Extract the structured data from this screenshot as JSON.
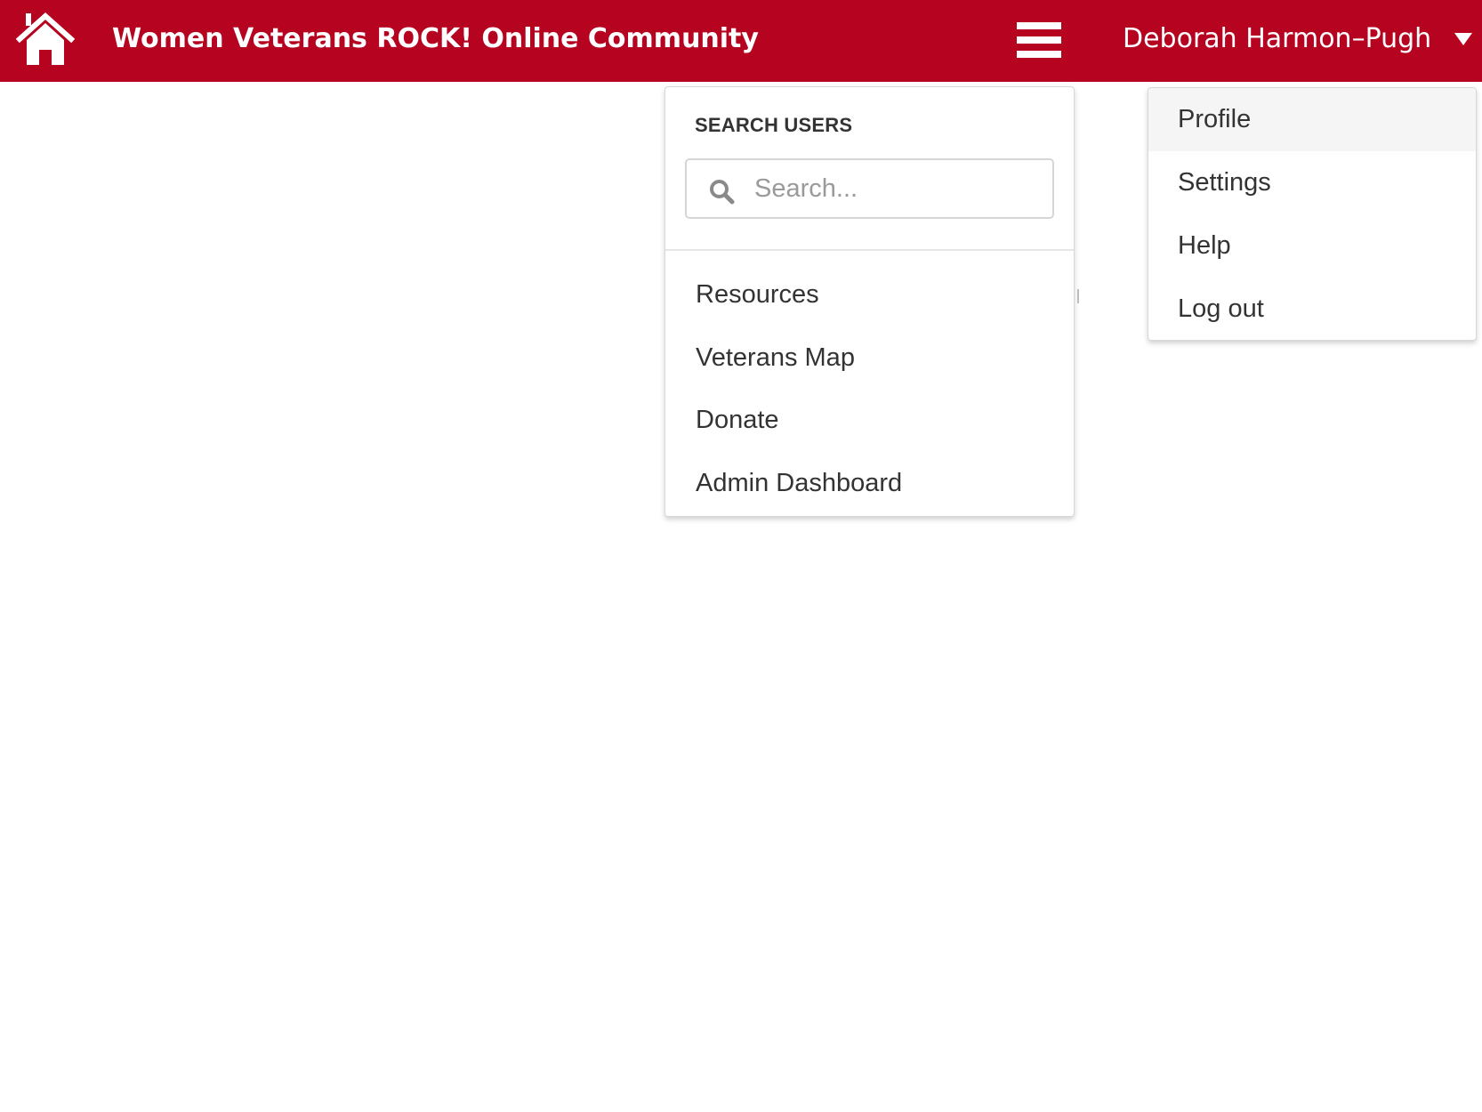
{
  "header": {
    "title": "Women Veterans ROCK! Online Community",
    "home_icon": "home-icon",
    "menu_icon": "hamburger-menu-icon",
    "user_name": "Deborah Harmon–Pugh",
    "user_caret_icon": "caret-down-icon",
    "background_color": "#b50320",
    "text_color": "#ffffff"
  },
  "nav_menu": {
    "search_heading": "SEARCH USERS",
    "search_placeholder": "Search...",
    "search_value": "",
    "search_icon": "search-icon",
    "items": [
      {
        "label": "Resources"
      },
      {
        "label": "Veterans Map"
      },
      {
        "label": "Donate"
      },
      {
        "label": "Admin Dashboard"
      }
    ]
  },
  "user_menu": {
    "active_item": "Profile",
    "items": [
      {
        "label": "Profile"
      },
      {
        "label": "Settings"
      },
      {
        "label": "Help"
      },
      {
        "label": "Log out"
      }
    ]
  }
}
